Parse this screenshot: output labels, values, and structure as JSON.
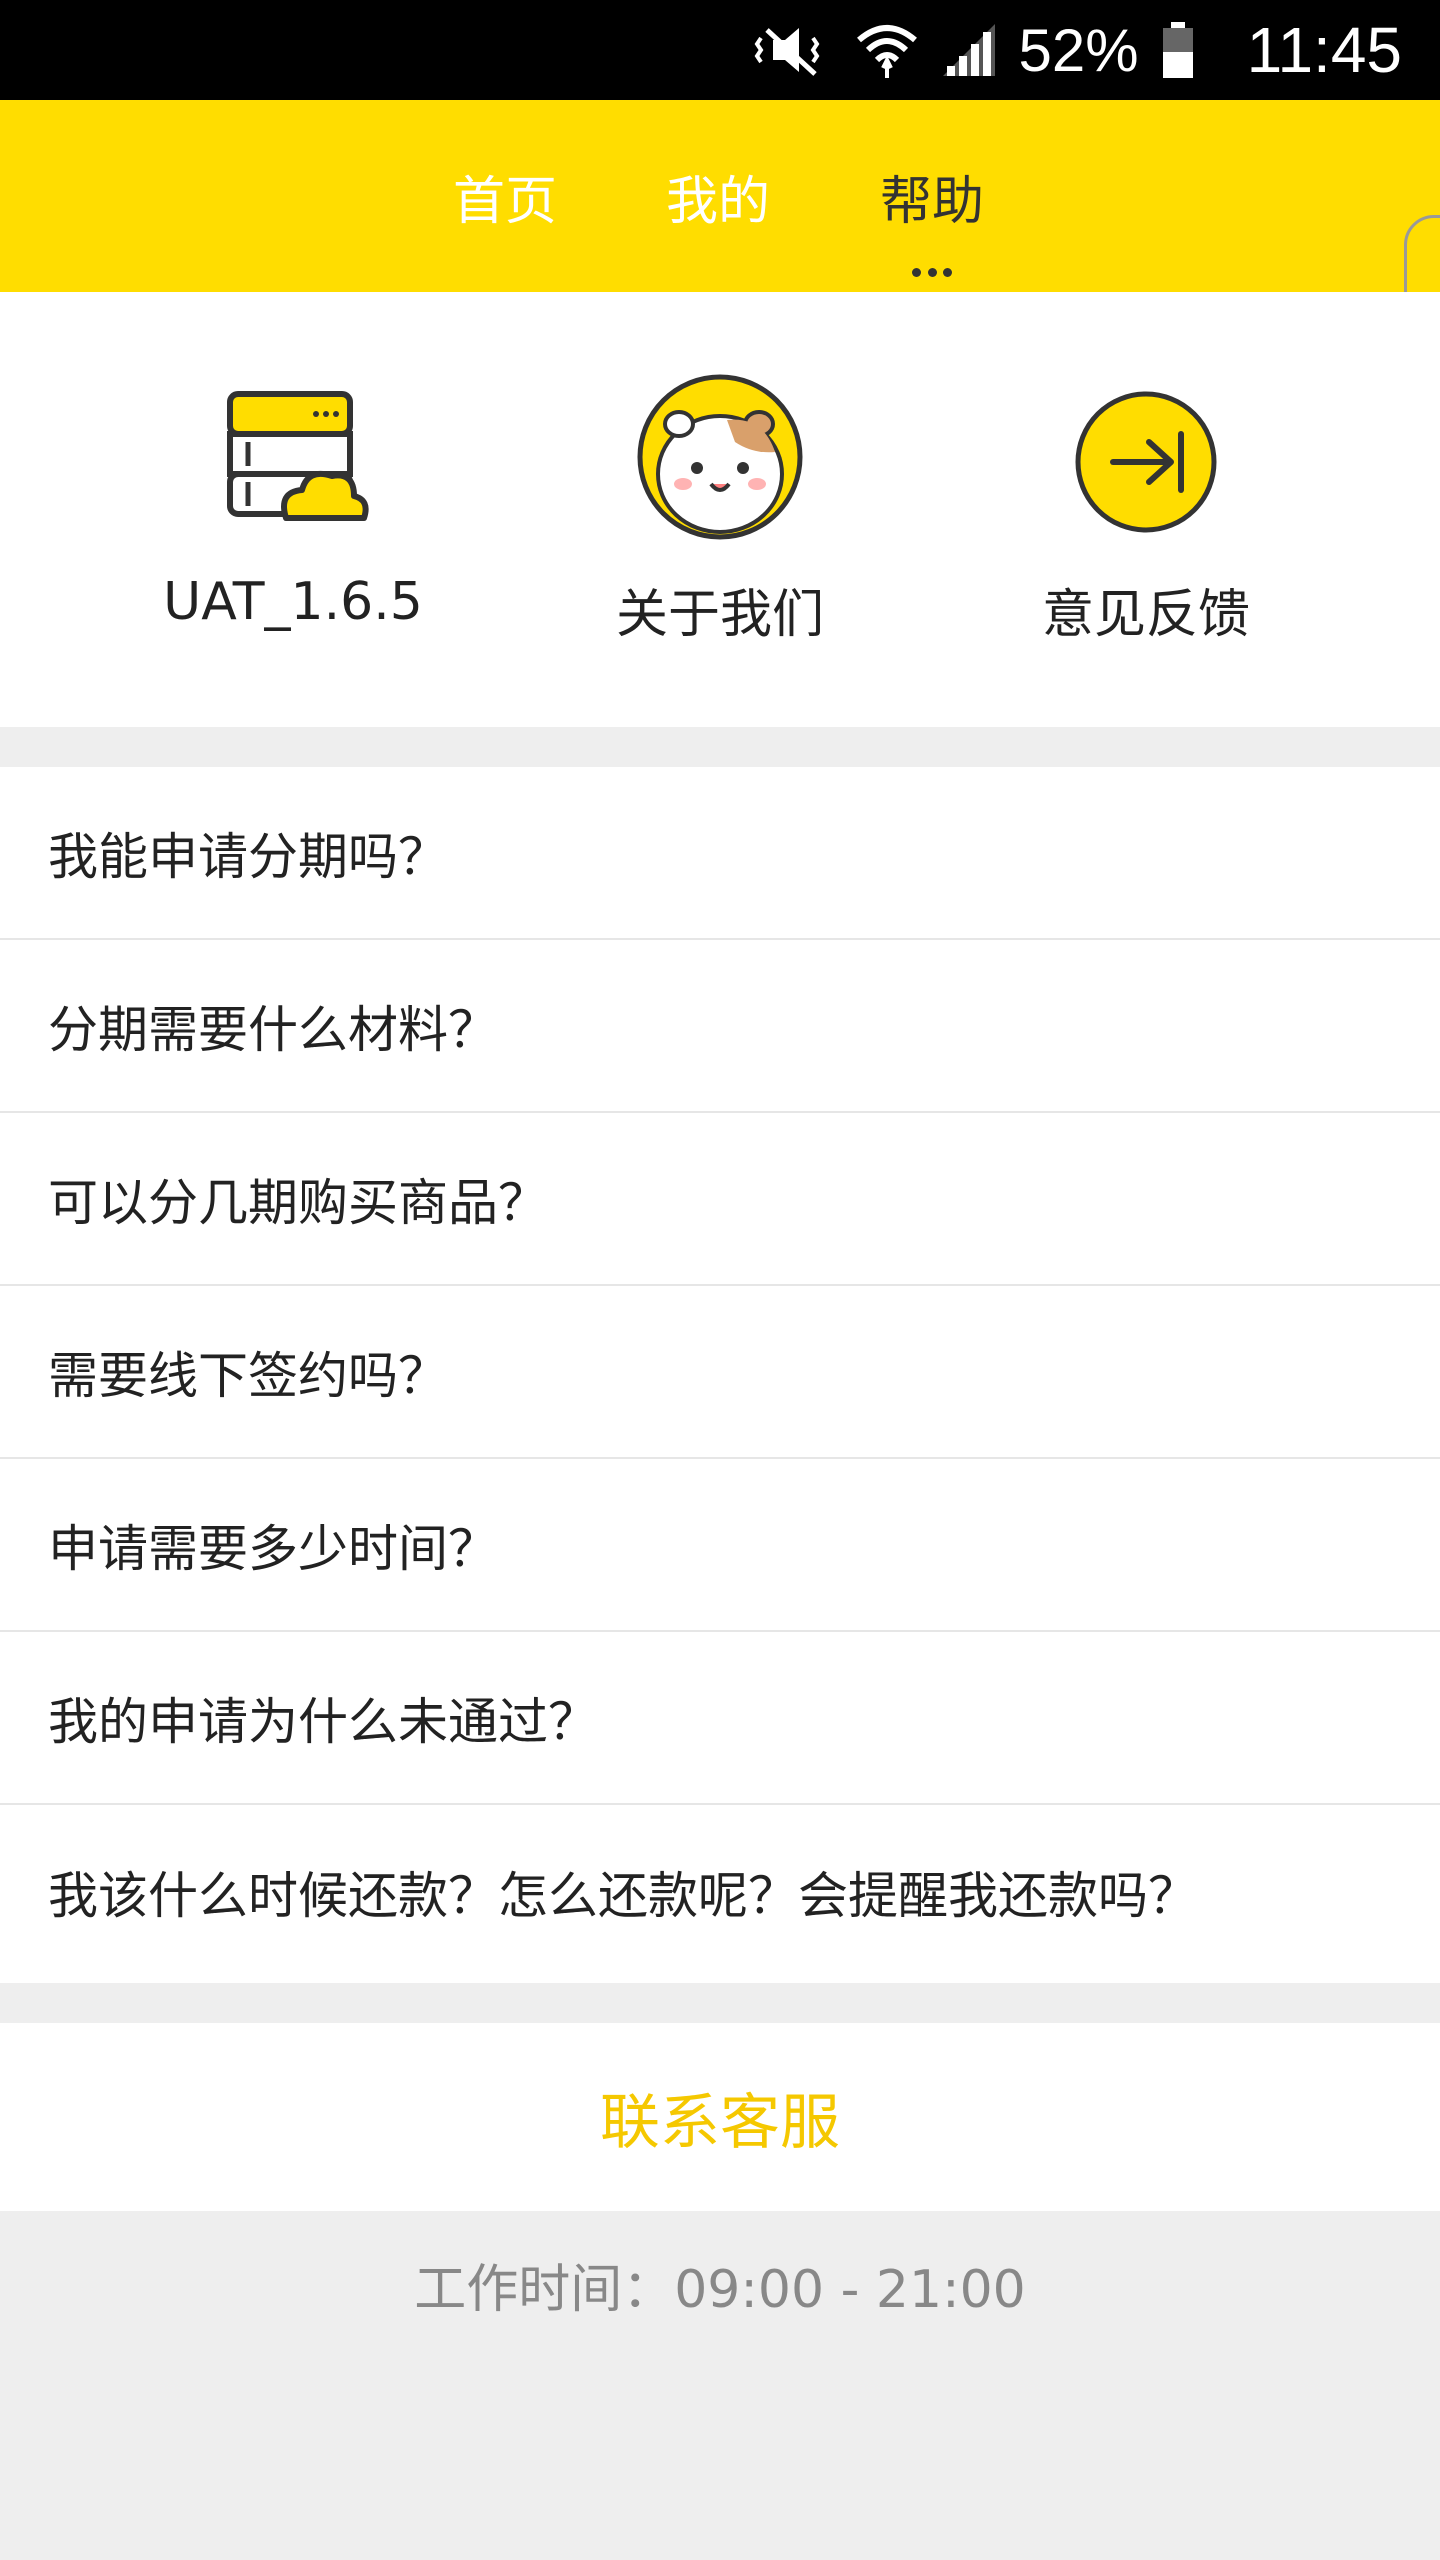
{
  "status_bar": {
    "battery_percent": "52%",
    "time": "11:45",
    "icons": [
      "mute-vibrate-icon",
      "wifi-icon",
      "signal-icon",
      "battery-icon"
    ]
  },
  "nav": {
    "tabs": [
      {
        "label": "首页",
        "active": false
      },
      {
        "label": "我的",
        "active": false
      },
      {
        "label": "帮助",
        "active": true
      }
    ],
    "background": "#ffdd00"
  },
  "shortcuts": [
    {
      "label": "UAT_1.6.5",
      "icon": "server-cloud-icon"
    },
    {
      "label": "关于我们",
      "icon": "hamster-avatar-icon"
    },
    {
      "label": "意见反馈",
      "icon": "arrow-to-right-icon"
    }
  ],
  "faq": [
    "我能申请分期吗？",
    "分期需要什么材料？",
    "可以分几期购买商品？",
    "需要线下签约吗？",
    "申请需要多少时间？",
    "我的申请为什么未通过？",
    "我该什么时候还款？怎么还款呢？会提醒我还款吗？"
  ],
  "contact": {
    "label": "联系客服",
    "color": "#f5c800"
  },
  "work_hours": "工作时间：09:00 - 21:00"
}
